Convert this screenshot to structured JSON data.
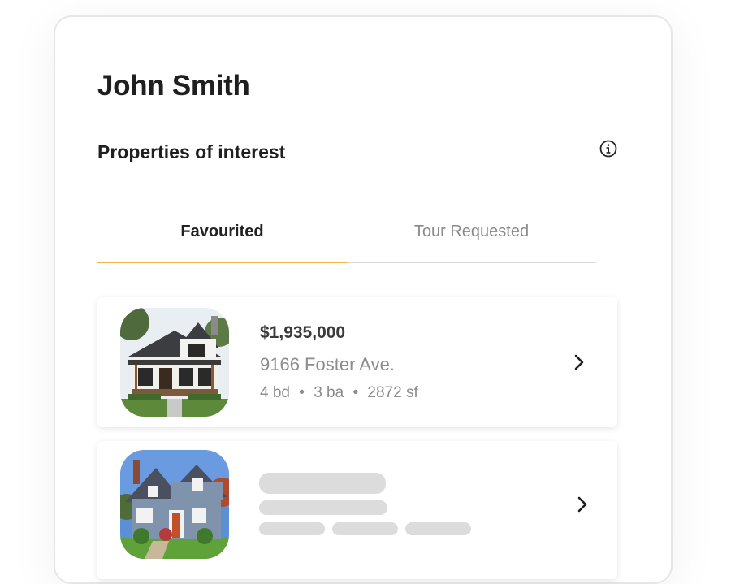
{
  "profile": {
    "name": "John Smith"
  },
  "section": {
    "title": "Properties of interest",
    "info_icon": "info-icon"
  },
  "tabs": [
    {
      "label": "Favourited",
      "active": true
    },
    {
      "label": "Tour Requested",
      "active": false
    }
  ],
  "accent_color": "#f2b54a",
  "properties": [
    {
      "price": "$1,935,000",
      "address": "9166 Foster Ave.",
      "beds": "4 bd",
      "baths": "3 ba",
      "area": "2872 sf",
      "separator": "•",
      "icon": "chevron-right-icon",
      "loaded": true
    },
    {
      "loaded": false,
      "icon": "chevron-right-icon"
    }
  ]
}
